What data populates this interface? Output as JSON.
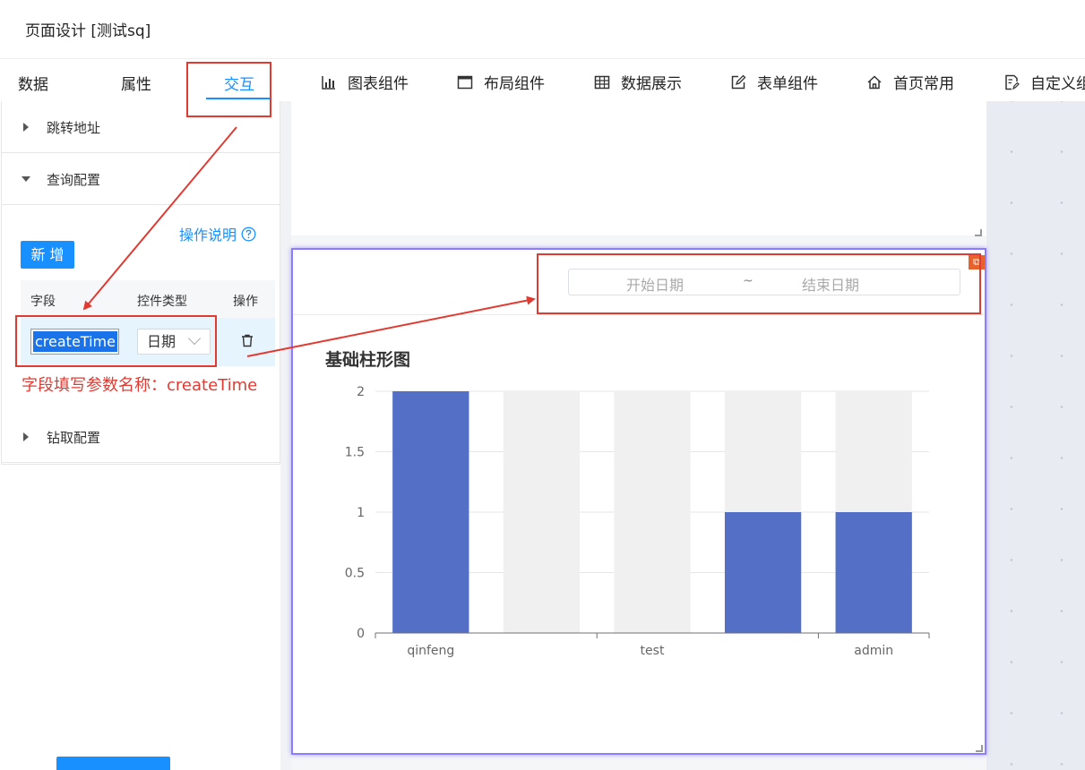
{
  "window": {
    "title": "页面设计 [测试sq]"
  },
  "left_tabs": [
    {
      "label": "数据"
    },
    {
      "label": "属性"
    },
    {
      "label": "交互",
      "active": true
    }
  ],
  "toolbar": [
    {
      "label": "图表组件",
      "icon": "bar-chart-icon"
    },
    {
      "label": "布局组件",
      "icon": "layout-icon"
    },
    {
      "label": "数据展示",
      "icon": "table-icon"
    },
    {
      "label": "表单组件",
      "icon": "form-edit-icon"
    },
    {
      "label": "首页常用",
      "icon": "home-icon"
    },
    {
      "label": "自定义组",
      "icon": "custom-icon"
    }
  ],
  "panel": {
    "jump": "跳转地址",
    "query": "查询配置",
    "help": "操作说明",
    "add": "新 增",
    "col_field": "字段",
    "col_type": "控件类型",
    "col_action": "操作",
    "row": {
      "field": "createTime",
      "type": "日期"
    },
    "drill": "钻取配置"
  },
  "annotation": {
    "note": "字段填写参数名称：createTime",
    "color": "#e03b32"
  },
  "widget": {
    "start_placeholder": "开始日期",
    "separator": "~",
    "end_placeholder": "结束日期",
    "chart_title": "基础柱形图"
  },
  "chart_data": {
    "type": "bar",
    "title": "基础柱形图",
    "categories": [
      "qinfeng",
      "",
      "test",
      "",
      "admin"
    ],
    "values": [
      2,
      0,
      0,
      1,
      1
    ],
    "ylim": [
      0,
      2
    ],
    "yticks": [
      0,
      0.5,
      1,
      1.5,
      2
    ],
    "show_background": true,
    "bar_color": "#5470c6",
    "background_color": "#f0f0f0",
    "grid": true
  }
}
